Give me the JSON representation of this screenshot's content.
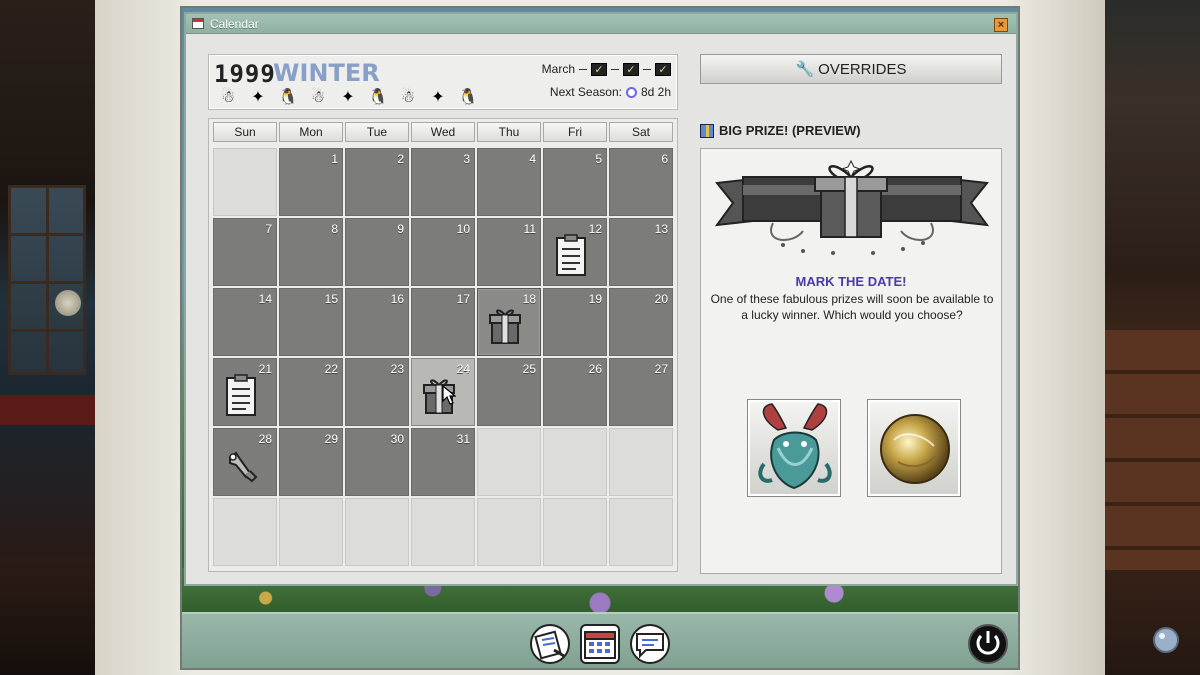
{
  "window": {
    "title": "Calendar"
  },
  "header": {
    "year": "1999",
    "season": "WINTER",
    "month_label": "March",
    "next_season_label": "Next Season:",
    "next_season_value": "8d 2h"
  },
  "weekdays": [
    "Sun",
    "Mon",
    "Tue",
    "Wed",
    "Thu",
    "Fri",
    "Sat"
  ],
  "days": [
    "1",
    "2",
    "3",
    "4",
    "5",
    "6",
    "7",
    "8",
    "9",
    "10",
    "11",
    "12",
    "13",
    "14",
    "15",
    "16",
    "17",
    "18",
    "19",
    "20",
    "21",
    "22",
    "23",
    "24",
    "25",
    "26",
    "27",
    "28",
    "29",
    "30",
    "31"
  ],
  "events": {
    "day12": "clipboard-icon",
    "day18": "gift-icon",
    "day21": "clipboard-icon",
    "day24": "gift-icon",
    "day28": "wrench-icon"
  },
  "right": {
    "overrides_label": "OVERRIDES",
    "prize_title": "BIG PRIZE! (PREVIEW)",
    "mark_date": "MARK THE DATE!",
    "description": "One of these fabulous prizes will soon be available to a lucky winner. Which would you choose?"
  },
  "colors": {
    "accent_purple": "#4a3ab0",
    "season_blue": "#88a0c8",
    "day_cell": "#7c7c7a",
    "check_green": "#b8e07a"
  }
}
